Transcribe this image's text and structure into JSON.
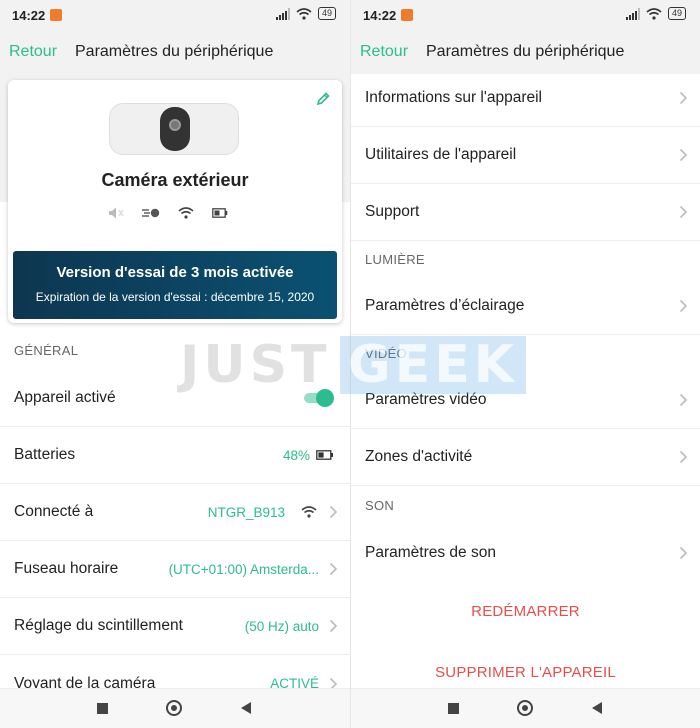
{
  "status_bar": {
    "time": "14:22",
    "battery": "49"
  },
  "left": {
    "back_label": "Retour",
    "title": "Paramètres du périphérique",
    "device_name": "Caméra extérieur",
    "trial": {
      "title": "Version d'essai de 3 mois activée",
      "subtitle": "Expiration de la version d'essai : décembre 15, 2020"
    },
    "section_general": "GÉNÉRAL",
    "rows": {
      "device_active": "Appareil activé",
      "batteries": "Batteries",
      "batteries_value": "48%",
      "connected": "Connecté à",
      "connected_value": "NTGR_B913",
      "timezone": "Fuseau horaire",
      "timezone_value": "(UTC+01:00) Amsterda...",
      "flicker": "Réglage du scintillement",
      "flicker_value": "(50 Hz) auto",
      "led": "Voyant de la caméra",
      "led_value": "ACTIVÉ"
    },
    "toggle_on": true,
    "battery_level": 0.48
  },
  "right": {
    "back_label": "Retour",
    "title": "Paramètres du périphérique",
    "rows": {
      "device_info": "Informations sur l'appareil",
      "utilities": "Utilitaires de l'appareil",
      "support": "Support",
      "lighting_settings": "Paramètres d’éclairage",
      "video_settings": "Paramètres vidéo",
      "activity_zones": "Zones d'activité",
      "sound_settings": "Paramètres de son"
    },
    "sections": {
      "light": "LUMIÈRE",
      "video": "VIDÉO",
      "sound": "SON"
    },
    "actions": {
      "restart": "REDÉMARRER",
      "delete": "SUPPRIMER L'APPAREIL"
    }
  },
  "watermark": {
    "part1": "JUST",
    "part2": "GEEK"
  },
  "colors": {
    "accent": "#2bbd8e",
    "danger": "#e5504a",
    "banner": "#0b4563"
  }
}
